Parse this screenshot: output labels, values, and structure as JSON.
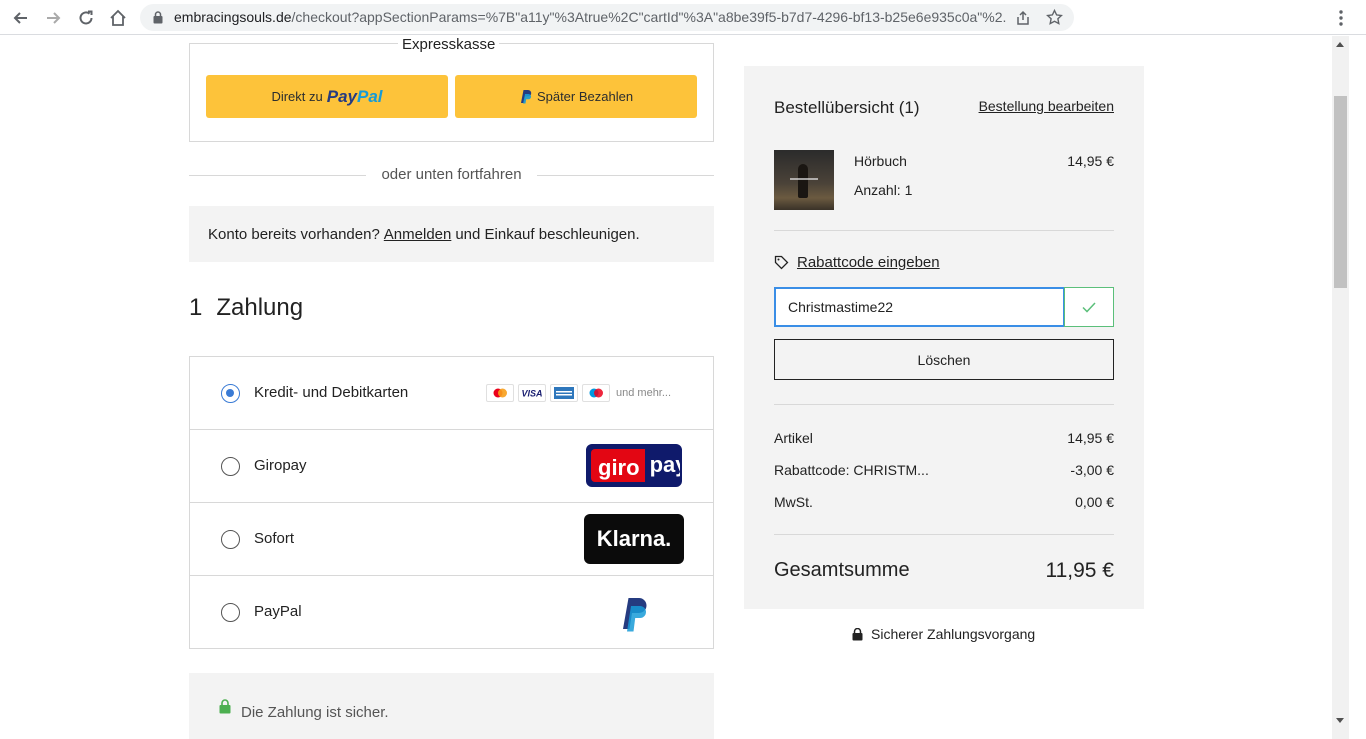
{
  "browser": {
    "url_host": "embracingsouls.de",
    "url_path": "/checkout?appSectionParams=%7B\"a11y\"%3Atrue%2C\"cartId\"%3A\"a8be39f5-b7d7-4296-bf13-b25e6e935c0a\"%2..."
  },
  "express": {
    "title": "Expresskasse",
    "paypal_prefix": "Direkt zu",
    "paypal_pay": "Pay",
    "paypal_pal": "Pal",
    "later_label": "Später Bezahlen"
  },
  "divider_label": "oder unten fortfahren",
  "login": {
    "prefix": "Konto bereits vorhanden?",
    "link": "Anmelden",
    "suffix": "und Einkauf beschleunigen."
  },
  "payment": {
    "number": "1",
    "title": "Zahlung",
    "methods": [
      {
        "label": "Kredit- und Debitkarten",
        "selected": true,
        "more": "und mehr..."
      },
      {
        "label": "Giropay",
        "selected": false,
        "logo_left": "giro",
        "logo_right": "pay"
      },
      {
        "label": "Sofort",
        "selected": false,
        "logo": "Klarna."
      },
      {
        "label": "PayPal",
        "selected": false
      }
    ]
  },
  "secure_note": "Die Zahlung ist sicher.",
  "summary": {
    "title": "Bestellübersicht (1)",
    "edit_link": "Bestellung bearbeiten",
    "item": {
      "name": "Hörbuch",
      "quantity": "Anzahl: 1",
      "price": "14,95 €"
    },
    "coupon_link": "Rabattcode eingeben",
    "coupon_value": "Christmastime22",
    "delete_label": "Löschen",
    "rows": [
      {
        "label": "Artikel",
        "value": "14,95 €"
      },
      {
        "label": "Rabattcode: CHRISTM...",
        "value": "-3,00 €"
      },
      {
        "label": "MwSt.",
        "value": "0,00 €"
      }
    ],
    "total_label": "Gesamtsumme",
    "total_value": "11,95 €"
  },
  "secure_payment": "Sicherer Zahlungsvorgang",
  "colors": {
    "paypal_button": "#fdc33a",
    "radio_selected": "#3a7bd5",
    "input_focus": "#3a8ee6",
    "check_green": "#5bbf7a",
    "lock_green": "#4caf50"
  }
}
